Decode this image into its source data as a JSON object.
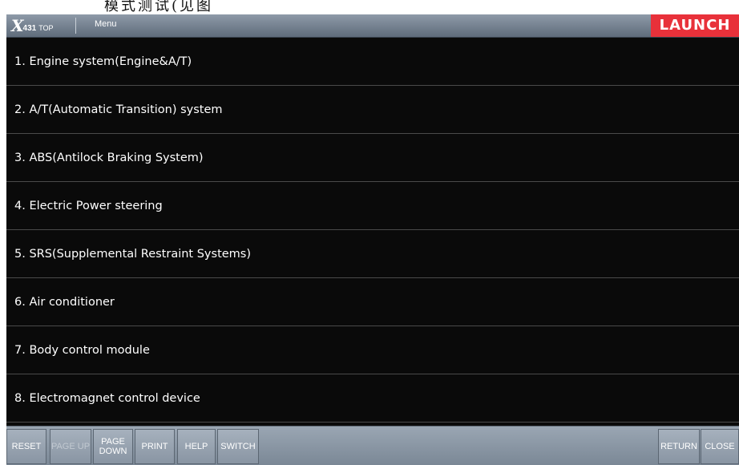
{
  "page": {
    "caption": "模式测试(见图"
  },
  "titlebar": {
    "logo": {
      "x": "X",
      "num": "431",
      "top": "TOP"
    },
    "menu_label": "Menu",
    "brand": "LAUNCH"
  },
  "menu": {
    "items": [
      {
        "label": "1. Engine system(Engine&A/T)"
      },
      {
        "label": "2. A/T(Automatic Transition) system"
      },
      {
        "label": "3. ABS(Antilock Braking System)"
      },
      {
        "label": "4. Electric Power steering"
      },
      {
        "label": "5. SRS(Supplemental Restraint Systems)"
      },
      {
        "label": "6. Air conditioner"
      },
      {
        "label": "7. Body control module"
      },
      {
        "label": "8. Electromagnet control device"
      }
    ]
  },
  "toolbar": {
    "reset": "RESET",
    "page_up": "PAGE UP",
    "page_down": "PAGE DOWN",
    "print": "PRINT",
    "help": "HELP",
    "switch": "SWITCH",
    "return": "RETURN",
    "close": "CLOSE"
  }
}
